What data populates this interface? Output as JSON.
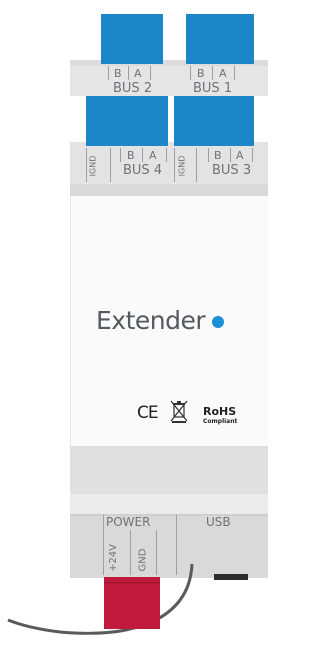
{
  "terminals": {
    "bus2": {
      "title": "BUS 2",
      "pin_b": "B",
      "pin_a": "A"
    },
    "bus1": {
      "title": "BUS 1",
      "pin_b": "B",
      "pin_a": "A"
    },
    "bus4": {
      "title": "BUS 4",
      "pin_gnd": "IGND",
      "pin_b": "B",
      "pin_a": "A"
    },
    "bus3": {
      "title": "BUS 3",
      "pin_gnd": "IGND",
      "pin_b": "B",
      "pin_a": "A"
    }
  },
  "front": {
    "brand": "Extender",
    "brand_dot_color": "#1d8fd6",
    "marks": {
      "ce": "CE",
      "rohs": "RoHS",
      "compliant": "Compliant"
    }
  },
  "bottom": {
    "power": {
      "title": "POWER",
      "pin_24v": "+24V",
      "pin_gnd": "GND"
    },
    "usb": {
      "title": "USB"
    }
  },
  "colors": {
    "connector_blue": "#1b86c8",
    "power_connector": "#c01b3c",
    "housing_light": "#e6e6e6",
    "front_panel": "#fafafa"
  }
}
